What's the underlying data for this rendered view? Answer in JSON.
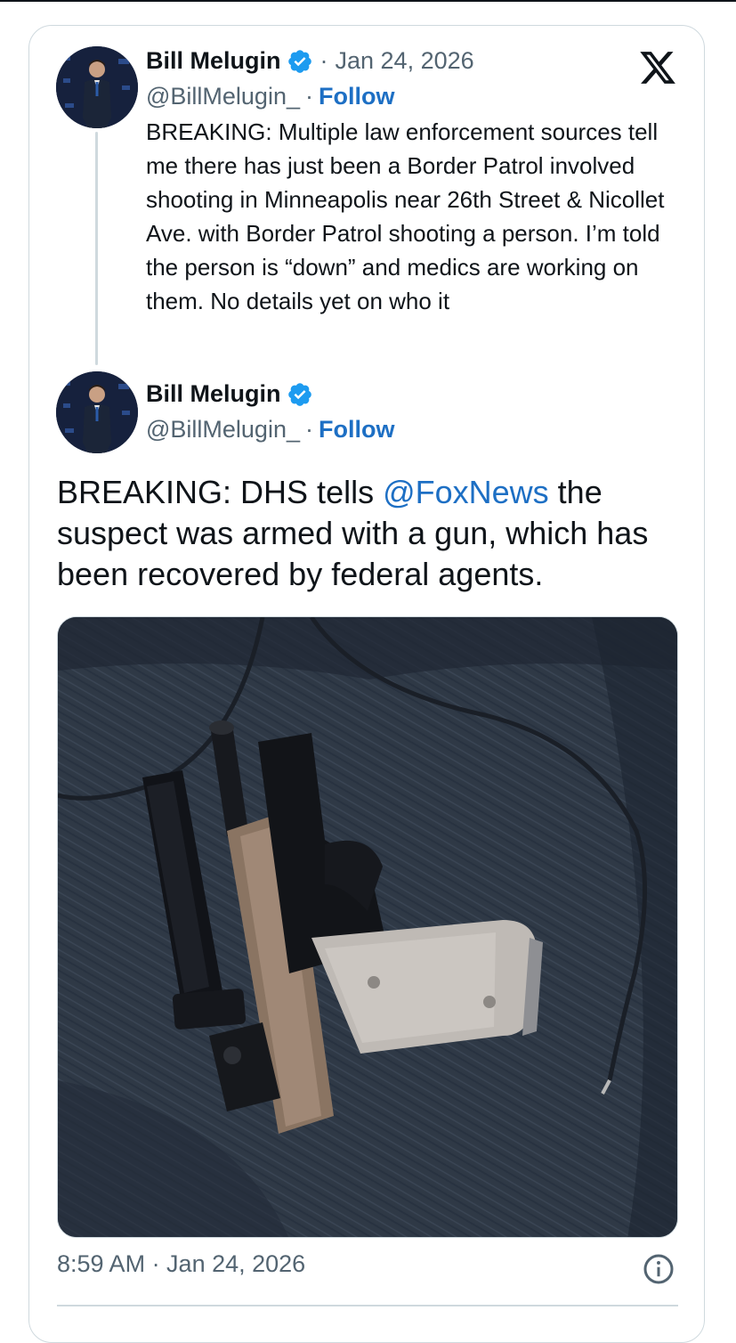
{
  "quoted_tweet": {
    "author_name": "Bill Melugin",
    "handle": "@BillMelugin_",
    "separator": "·",
    "date": "Jan 24, 2026",
    "follow_label": "Follow",
    "text": "BREAKING: Multiple law enforcement sources tell me there has just been a Border Patrol involved shooting in Minneapolis near 26th Street & Nicollet Ave. with Border Patrol shooting a person. I’m told the person is “down” and medics are working on them. No details yet on who it"
  },
  "main_tweet": {
    "author_name": "Bill Melugin",
    "handle": "@BillMelugin_",
    "separator": "·",
    "follow_label": "Follow",
    "text_before_mention": "BREAKING: DHS tells ",
    "mention": "@FoxNews",
    "text_after_mention": " the suspect was armed with a gun, which has been recovered by federal agents.",
    "timestamp": "8:59 AM · Jan 24, 2026"
  },
  "icons": {
    "platform_logo": "x-logo-icon",
    "verified": "verified-badge-icon",
    "info": "info-icon"
  },
  "colors": {
    "link_blue": "#1d6fc4",
    "verified_blue": "#1d9bf0",
    "muted_text": "#536471",
    "border": "#cfd9de"
  }
}
